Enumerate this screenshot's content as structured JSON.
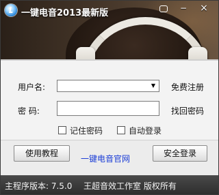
{
  "window": {
    "title": "一键电音2013最新版",
    "buttons": {
      "skin": "skin-icon",
      "minimize": "−",
      "close": "×"
    }
  },
  "login": {
    "username_label": "用户名:",
    "username_value": "",
    "password_label": "密  码:",
    "password_value": "",
    "register_link": "免费注册",
    "recover_link": "找回密码",
    "remember_label": "记住密码",
    "remember_checked": false,
    "autologin_label": "自动登录",
    "autologin_checked": false
  },
  "buttons": {
    "tutorial": "使用教程",
    "site_link": "一键电音官网",
    "login": "安全登录"
  },
  "status": {
    "version": "主程序版本: 7.5.0",
    "copyright": "王超音效工作室 版权所有"
  },
  "colors": {
    "status_bar": "#3a3a3a",
    "site_link": "#1a3cd6",
    "background": "#f3f3f3"
  }
}
